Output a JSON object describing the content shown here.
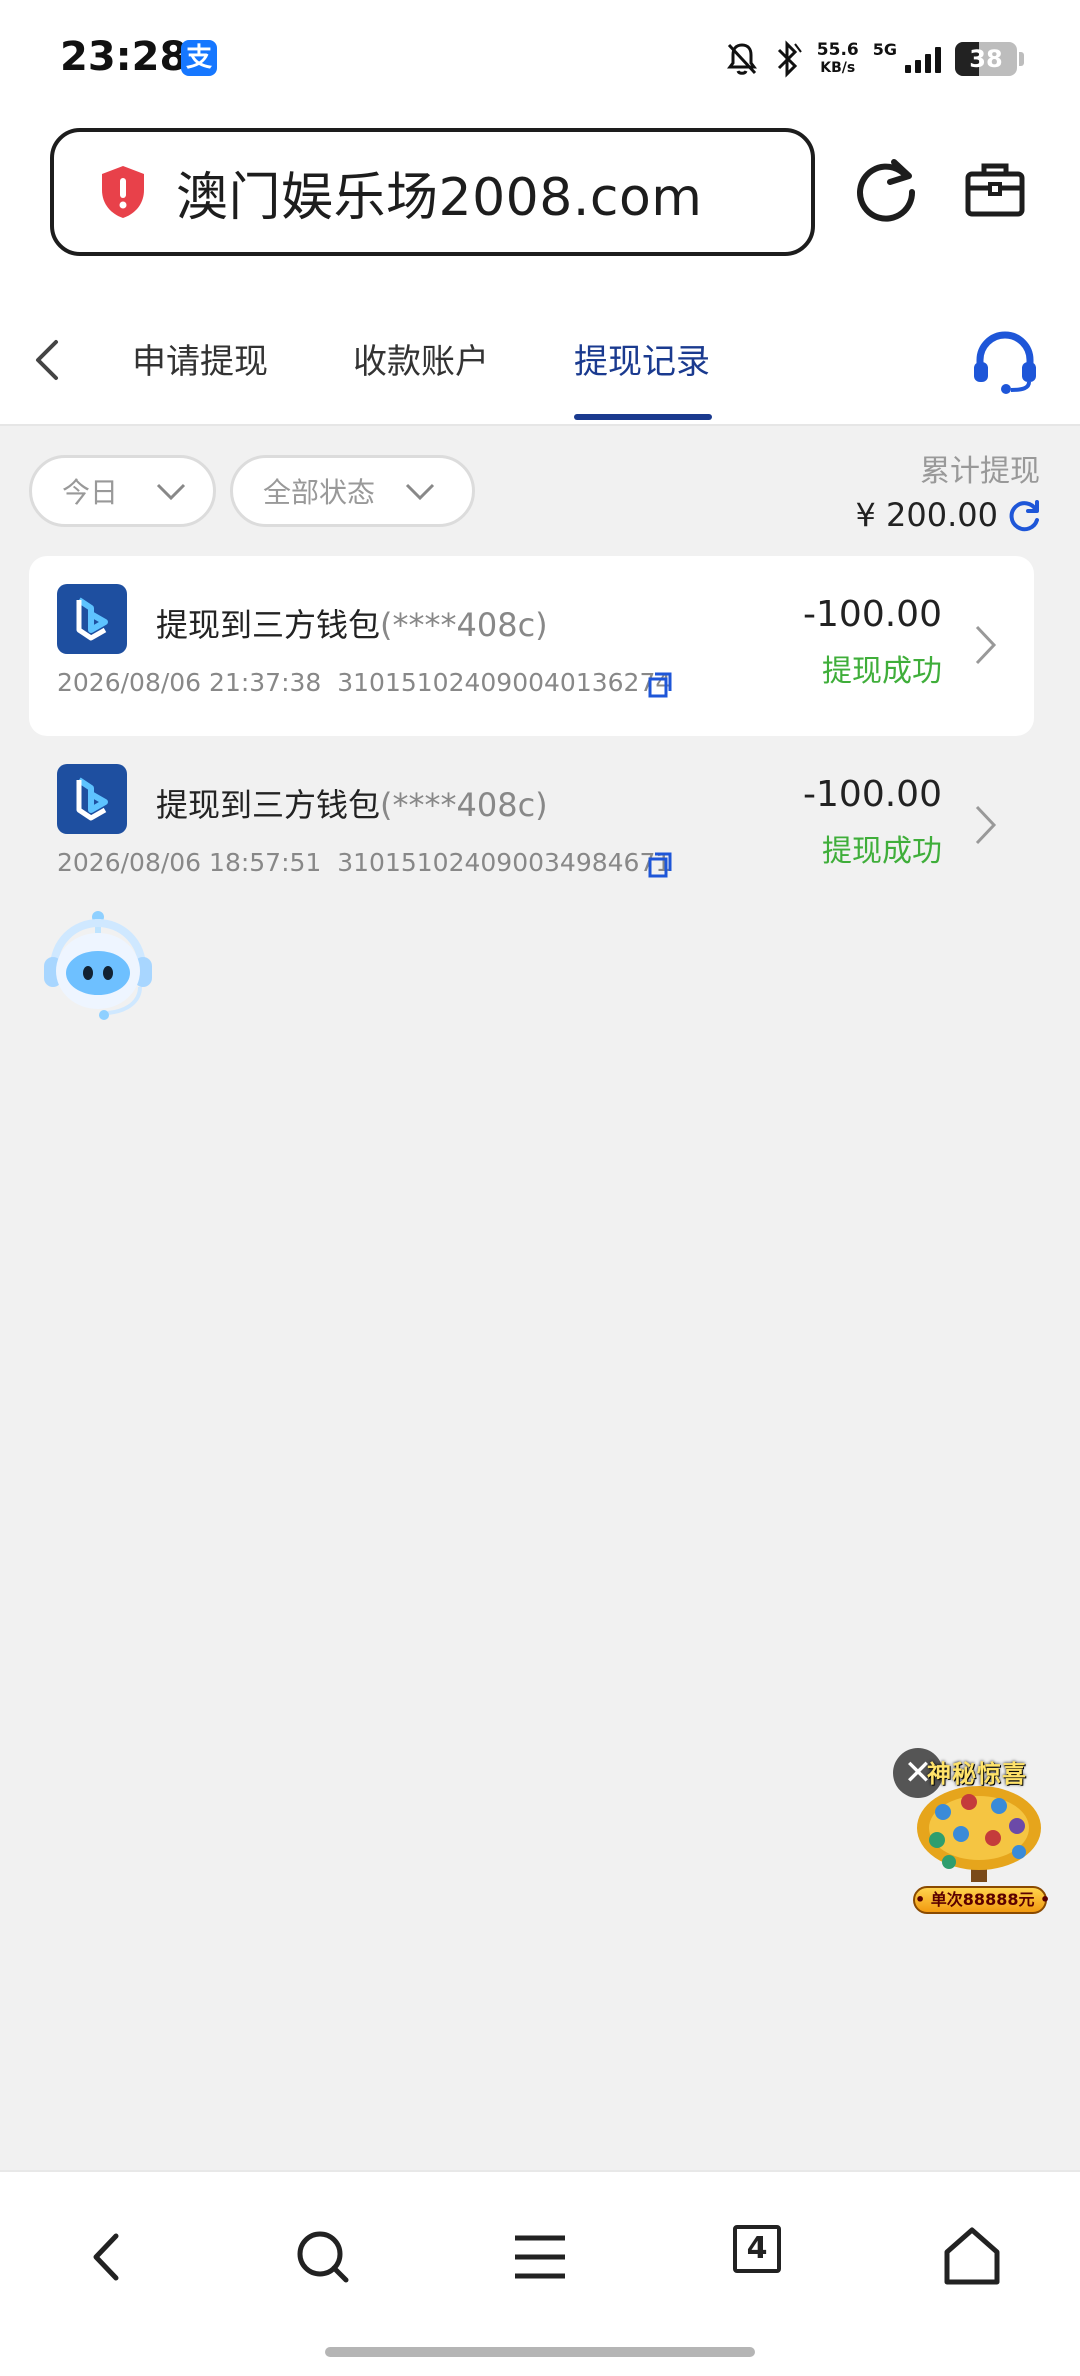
{
  "status_bar": {
    "time": "23:28",
    "alipay_glyph": "支",
    "net_speed_value": "55.6",
    "net_speed_unit": "KB/s",
    "network": "5G",
    "battery": "38",
    "icons": [
      "alipay-icon",
      "mute-icon",
      "bluetooth-icon",
      "signal-icon",
      "battery-icon"
    ]
  },
  "browser": {
    "url": "澳门娱乐场2008.com",
    "icons": [
      "warning-shield-icon",
      "reload-icon",
      "toolbox-icon"
    ]
  },
  "tabs": {
    "items": [
      {
        "label": "申请提现",
        "active": false
      },
      {
        "label": "收款账户",
        "active": false
      },
      {
        "label": "提现记录",
        "active": true
      }
    ],
    "accent_color": "#1a3a8f"
  },
  "filters": {
    "date": "今日",
    "status": "全部状态"
  },
  "summary": {
    "label": "累计提现",
    "amount": "¥ 200.00"
  },
  "records": [
    {
      "title": "提现到三方钱包",
      "account": "(****408c)",
      "datetime": "2026/08/06 21:37:38",
      "order_no": "310151024090040136274",
      "amount": "-100.00",
      "status": "提现成功"
    },
    {
      "title": "提现到三方钱包",
      "account": "(****408c)",
      "datetime": "2026/08/06 18:57:51",
      "order_no": "310151024090034984671",
      "amount": "-100.00",
      "status": "提现成功"
    }
  ],
  "promo": {
    "close": "✕",
    "title": "神秘惊喜",
    "subtitle": "• 单次88888元 •"
  },
  "bottom_nav": {
    "tab_count": "4",
    "icons": [
      "back-icon",
      "search-icon",
      "menu-icon",
      "tabs-icon",
      "home-icon"
    ]
  },
  "colors": {
    "success": "#3fae3a",
    "brand": "#1e4fa0",
    "warning": "#e8414a"
  }
}
